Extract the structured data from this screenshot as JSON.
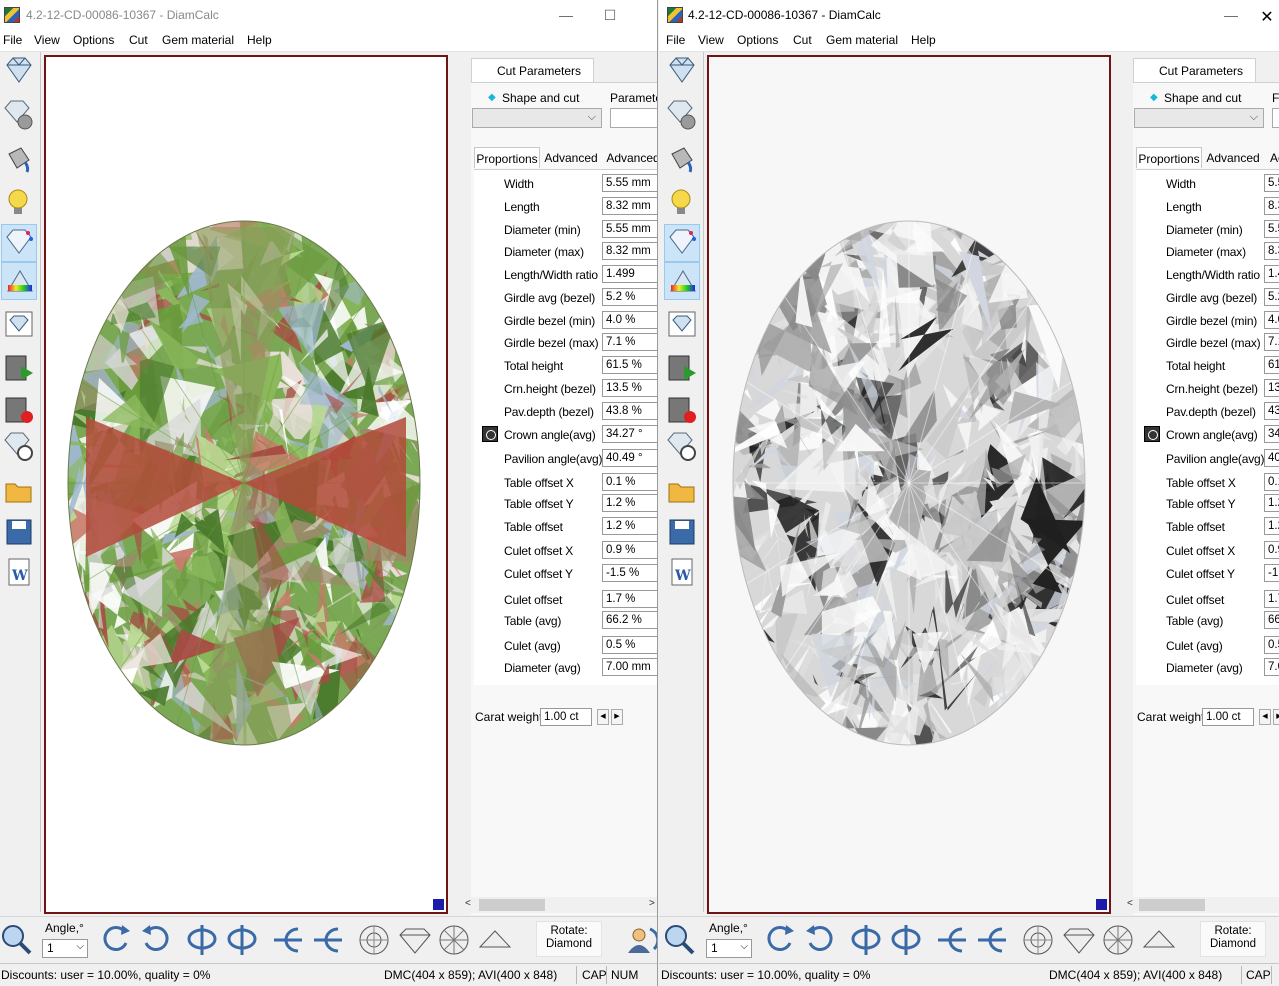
{
  "left": {
    "title": "4.2-12-CD-00086-10367 - DiamCalc",
    "window_controls": {
      "minimize": "—",
      "maximize": "☐"
    },
    "menu": [
      "File",
      "View",
      "Options",
      "Cut",
      "Gem material",
      "Help"
    ],
    "panel": {
      "tab": "Cut Parameters",
      "shape_label": "Shape and cut",
      "params_label": "Parameter",
      "subtabs": [
        "Proportions",
        "Advanced",
        "Advanced"
      ],
      "props": [
        {
          "label": "Width",
          "value": "5.55 mm"
        },
        {
          "label": "Length",
          "value": "8.32 mm"
        },
        {
          "label": "Diameter (min)",
          "value": "5.55 mm"
        },
        {
          "label": "Diameter (max)",
          "value": "8.32 mm"
        },
        {
          "label": "Length/Width ratio",
          "value": "1.499"
        },
        {
          "label": "Girdle avg (bezel)",
          "value": "5.2 %"
        },
        {
          "label": "Girdle bezel (min)",
          "value": "4.0 %"
        },
        {
          "label": "Girdle bezel (max)",
          "value": "7.1 %"
        },
        {
          "label": "Total height",
          "value": "61.5 %"
        },
        {
          "label": "Crn.height (bezel)",
          "value": "13.5 %"
        },
        {
          "label": "Pav.depth (bezel)",
          "value": "43.8 %"
        },
        {
          "label": "Crown angle(avg)",
          "value": "34.27 °"
        },
        {
          "label": "Pavilion angle(avg)",
          "value": "40.49 °"
        },
        {
          "label": "Table offset X",
          "value": "0.1 %"
        },
        {
          "label": "Table offset Y",
          "value": "1.2 %"
        },
        {
          "label": "Table offset",
          "value": "1.2 %"
        },
        {
          "label": "Culet offset X",
          "value": "0.9 %"
        },
        {
          "label": "Culet offset Y",
          "value": "-1.5 %"
        },
        {
          "label": "Culet offset",
          "value": "1.7 %"
        },
        {
          "label": "Table (avg)",
          "value": "66.2 %"
        },
        {
          "label": "Culet (avg)",
          "value": "0.5 %"
        },
        {
          "label": "Diameter (avg)",
          "value": "7.00 mm"
        }
      ],
      "carat_label": "Carat weight",
      "carat_value": "1.00 ct"
    },
    "bottom": {
      "angle_label": "Angle,°",
      "angle_value": "1",
      "rotate_label": "Rotate:",
      "rotate_value": "Diamond"
    },
    "status": {
      "discounts": "Discounts: user = 10.00%, quality = 0%",
      "sizes": "DMC(404 x 859); AVI(400 x 848)",
      "cap": "CAP",
      "num": "NUM"
    }
  },
  "right": {
    "title": "4.2-12-CD-00086-10367 - DiamCalc",
    "window_controls": {
      "minimize": "—"
    },
    "menu": [
      "File",
      "View",
      "Options",
      "Cut",
      "Gem material",
      "Help"
    ],
    "panel": {
      "tab": "Cut Parameters",
      "shape_label": "Shape and cut",
      "params_label": "F",
      "subtabs": [
        "Proportions",
        "Advanced",
        "Ac"
      ],
      "props": [
        {
          "label": "Width",
          "value": "5.5"
        },
        {
          "label": "Length",
          "value": "8.3"
        },
        {
          "label": "Diameter (min)",
          "value": "5.5"
        },
        {
          "label": "Diameter (max)",
          "value": "8.3"
        },
        {
          "label": "Length/Width ratio",
          "value": "1.4"
        },
        {
          "label": "Girdle avg (bezel)",
          "value": "5.2"
        },
        {
          "label": "Girdle bezel (min)",
          "value": "4.0"
        },
        {
          "label": "Girdle bezel (max)",
          "value": "7.1"
        },
        {
          "label": "Total height",
          "value": "61"
        },
        {
          "label": "Crn.height (bezel)",
          "value": "13"
        },
        {
          "label": "Pav.depth (bezel)",
          "value": "43"
        },
        {
          "label": "Crown angle(avg)",
          "value": "34"
        },
        {
          "label": "Pavilion angle(avg)",
          "value": "40"
        },
        {
          "label": "Table offset X",
          "value": "0.1"
        },
        {
          "label": "Table offset Y",
          "value": "1.2"
        },
        {
          "label": "Table offset",
          "value": "1.2"
        },
        {
          "label": "Culet offset X",
          "value": "0.9"
        },
        {
          "label": "Culet offset Y",
          "value": "-1."
        },
        {
          "label": "Culet offset",
          "value": "1.7"
        },
        {
          "label": "Table (avg)",
          "value": "66"
        },
        {
          "label": "Culet (avg)",
          "value": "0.5"
        },
        {
          "label": "Diameter (avg)",
          "value": "7.0"
        }
      ],
      "carat_label": "Carat weight",
      "carat_value": "1.00 ct"
    },
    "bottom": {
      "angle_label": "Angle,°",
      "angle_value": "1",
      "rotate_label": "Rotate:",
      "rotate_value": "Diamond"
    },
    "status": {
      "discounts": "Discounts: user = 10.00%, quality = 0%",
      "sizes": "DMC(404 x 859); AVI(400 x 848)",
      "cap": "CAP"
    }
  },
  "colors": {
    "viewport_border": "#6e1414",
    "corner_marker": "#1c1ca8",
    "active_tool": "#cce4f7"
  },
  "icons": [
    "diamond-icon",
    "diamond-lightbulb-icon",
    "paint-bucket-icon",
    "lightbulb-icon",
    "diamond-sparkle-icon",
    "spectrum-icon",
    "diamond-image-icon",
    "film-play-icon",
    "film-record-icon",
    "diamond-wheel-icon",
    "open-folder-icon",
    "save-disk-icon",
    "word-doc-icon",
    "zoom-icon",
    "rotate-ccw-icon",
    "rotate-cw-icon",
    "flip-horizontal-icon",
    "flip-vertical-icon",
    "tilt-left-icon",
    "tilt-right-icon",
    "top-view-icon",
    "side-view-icon",
    "bottom-view-icon",
    "pavilion-view-icon",
    "user-rotate-icon"
  ]
}
